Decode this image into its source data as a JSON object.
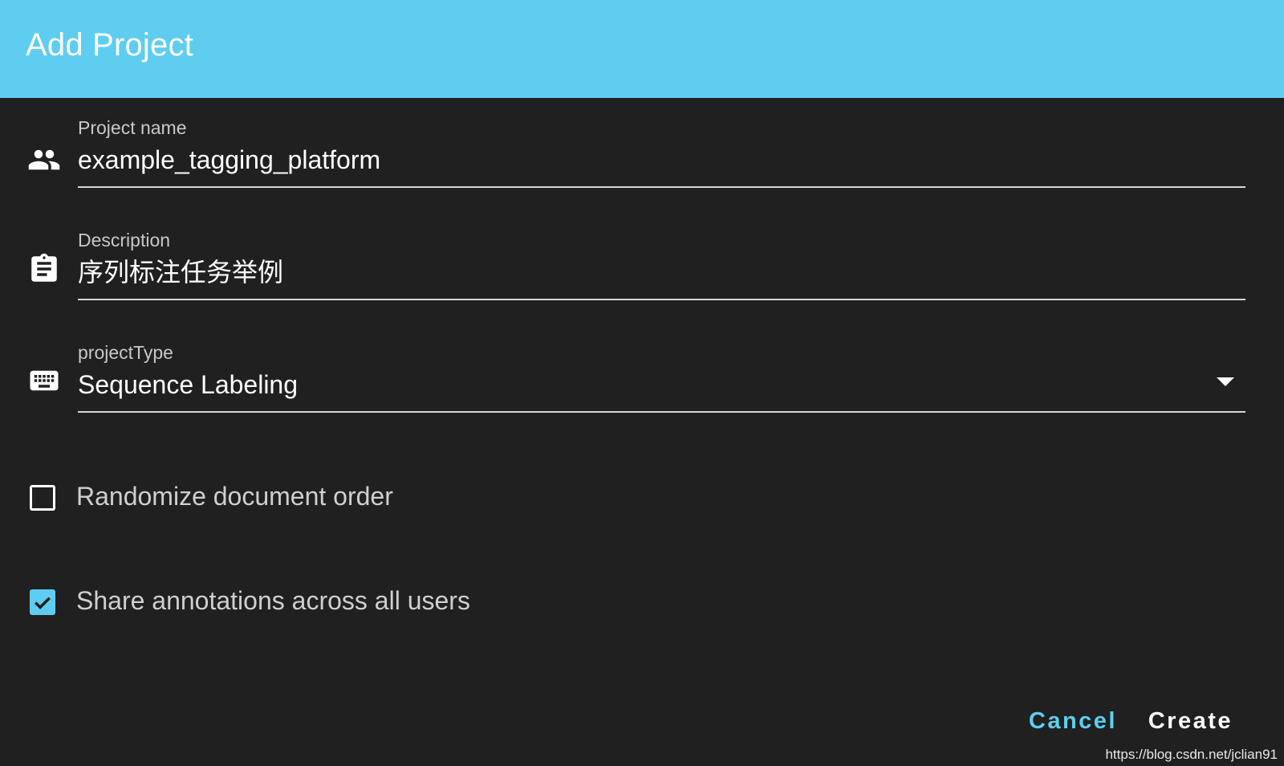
{
  "dialog": {
    "title": "Add Project"
  },
  "fields": {
    "project_name": {
      "label": "Project name",
      "value": "example_tagging_platform",
      "icon": "people-icon"
    },
    "description": {
      "label": "Description",
      "value": "序列标注任务举例",
      "icon": "clipboard-icon"
    },
    "project_type": {
      "label": "projectType",
      "value": "Sequence Labeling",
      "icon": "keyboard-icon"
    }
  },
  "options": {
    "randomize": {
      "label": "Randomize document order",
      "checked": false
    },
    "share": {
      "label": "Share annotations across all users",
      "checked": true
    }
  },
  "actions": {
    "cancel_label": "Cancel",
    "create_label": "Create"
  },
  "watermark": "https://blog.csdn.net/jclian91",
  "colors": {
    "accent": "#5ecdf0",
    "background": "#202020"
  }
}
